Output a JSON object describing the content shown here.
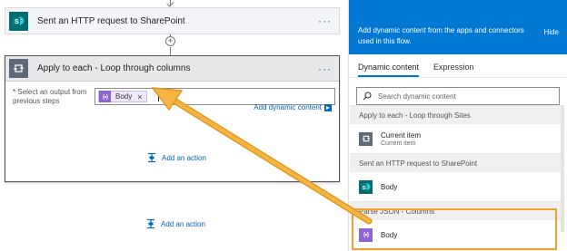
{
  "flow": {
    "sharepoint_card": {
      "title": "Sent an HTTP request to SharePoint",
      "more": "···",
      "icon": "sharepoint-icon"
    },
    "add_step_symbol": "+",
    "apply_card": {
      "title": "Apply to each - Loop through columns",
      "more": "···",
      "icon": "loop-icon",
      "field": {
        "required_marker": "*",
        "label": "Select an output from previous steps",
        "token": {
          "label": "Body",
          "close": "×",
          "icon": "expression-icon"
        }
      },
      "add_dynamic_label": "Add dynamic content",
      "add_action_label": "Add an action"
    },
    "add_action_label": "Add an action"
  },
  "panel": {
    "message": "Add dynamic content from the apps and connectors used in this flow.",
    "hide_label": "Hide",
    "tabs": [
      {
        "label": "Dynamic content",
        "active": true
      },
      {
        "label": "Expression",
        "active": false
      }
    ],
    "search": {
      "placeholder": "Search dynamic content"
    },
    "groups": [
      {
        "header": "Apply to each - Loop through Sites",
        "items": [
          {
            "title": "Current item",
            "subtitle": "Current item",
            "icon": "loop-icon",
            "color": "#5e6a7a"
          }
        ]
      },
      {
        "header": "Sent an HTTP request to SharePoint",
        "items": [
          {
            "title": "Body",
            "subtitle": "",
            "icon": "sharepoint-icon",
            "color": "#036c70"
          }
        ]
      },
      {
        "header": "Parse JSON - Columns",
        "items": [
          {
            "title": "Body",
            "subtitle": "",
            "icon": "expression-icon",
            "color": "#8e63d6"
          }
        ]
      }
    ]
  },
  "colors": {
    "accent": "#0078d4",
    "link": "#0067b8",
    "highlight": "#f0a030",
    "token": "#8e63d6",
    "sharepoint": "#036c70"
  }
}
